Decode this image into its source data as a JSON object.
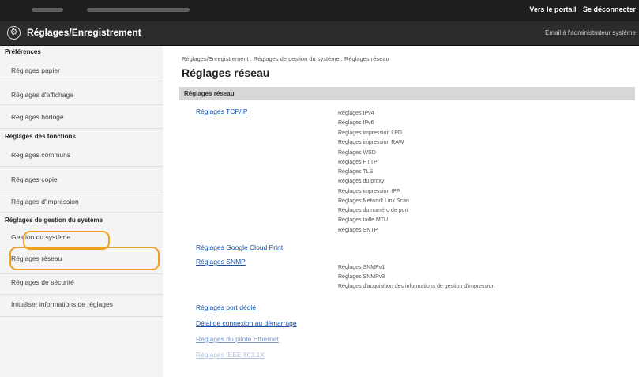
{
  "header": {
    "links": [
      "Vers le portail",
      "Se déconnecter"
    ],
    "app_title": "Réglages/Enregistrement",
    "email_link": "Email à l'administrateur système"
  },
  "sidebar": {
    "groups": [
      {
        "title": "Préférences",
        "items": [
          "Réglages papier",
          "Réglages d'affichage",
          "Réglages horloge"
        ]
      },
      {
        "title": "Réglages des fonctions",
        "items": [
          "Réglages communs",
          "Réglages copie",
          "Réglages d'impression"
        ]
      },
      {
        "title": "Réglages de gestion du système",
        "items": [
          "Gestion du système",
          "Réglages réseau",
          "Réglages de sécurité",
          "Initialiser informations de réglages"
        ]
      }
    ]
  },
  "main": {
    "breadcrumb": "Réglages/Enregistrement : Réglages de gestion du système : Réglages réseau",
    "title": "Réglages réseau",
    "section_header": "Réglages réseau",
    "links": [
      "Réglages TCP/IP",
      "Réglages Google Cloud Print",
      "Réglages SNMP",
      "Réglages port dédié",
      "Délai de connexion au démarrage",
      "Réglages du pilote Ethernet",
      "Réglages IEEE 802.1X"
    ],
    "tcpip_subitems": [
      "Réglages IPv4",
      "Réglages IPv6",
      "Réglages impression LPD",
      "Réglages impression RAW",
      "Réglages WSD",
      "Réglages HTTP",
      "Réglages TLS",
      "Réglages du proxy",
      "Réglages impression IPP",
      "Réglages Network Link Scan",
      "Réglages du numéro de port",
      "Réglages taille MTU",
      "Réglages SNTP"
    ],
    "snmp_subitems": [
      "Réglages SNMPv1",
      "Réglages SNMPv3",
      "Réglages d'acquisition des informations de gestion d'impression"
    ]
  },
  "colors": {
    "highlight": "#f0a020",
    "link": "#1a4fa0",
    "topbar": "#1e1e1e"
  }
}
